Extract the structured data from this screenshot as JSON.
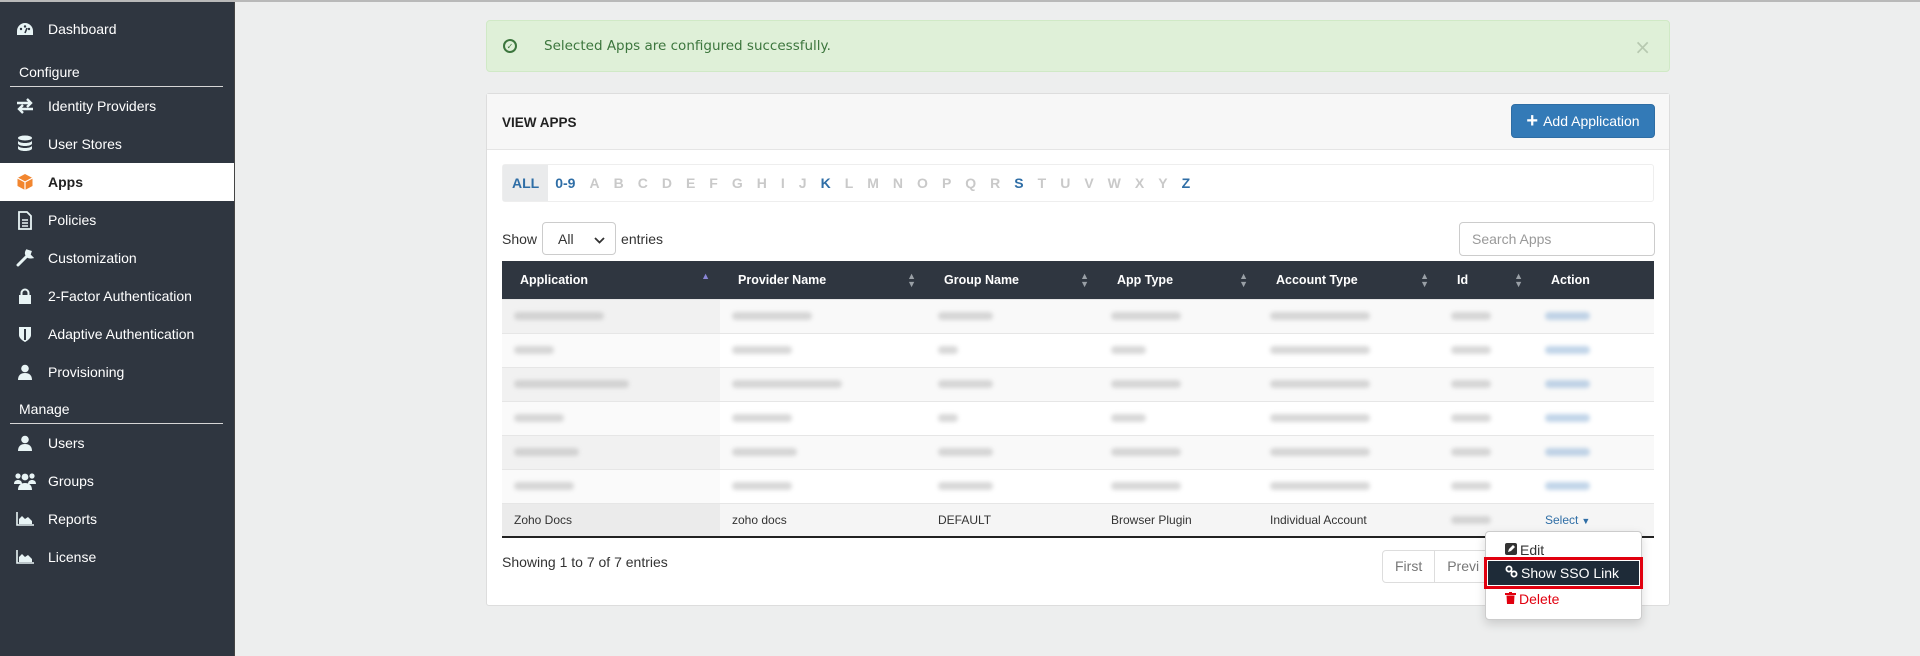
{
  "sidebar": {
    "items": [
      {
        "label": "Dashboard",
        "icon": "dashboard-icon"
      },
      {
        "section": "Configure"
      },
      {
        "label": "Identity Providers",
        "icon": "exchange-icon"
      },
      {
        "label": "User Stores",
        "icon": "database-icon"
      },
      {
        "label": "Apps",
        "icon": "cube-icon",
        "active": true
      },
      {
        "label": "Policies",
        "icon": "document-icon"
      },
      {
        "label": "Customization",
        "icon": "wrench-icon"
      },
      {
        "label": "2-Factor Authentication",
        "icon": "lock-icon"
      },
      {
        "label": "Adaptive Authentication",
        "icon": "shield-icon"
      },
      {
        "label": "Provisioning",
        "icon": "user-icon"
      },
      {
        "section": "Manage"
      },
      {
        "label": "Users",
        "icon": "user-icon"
      },
      {
        "label": "Groups",
        "icon": "users-icon"
      },
      {
        "label": "Reports",
        "icon": "area-chart-icon"
      },
      {
        "label": "License",
        "icon": "area-chart-icon"
      }
    ]
  },
  "alert": {
    "message": "Selected Apps are configured successfully.",
    "close": "×",
    "color": "#dff0d8"
  },
  "panel": {
    "title": "VIEW APPS",
    "add_button": "Add Application",
    "add_icon": "+"
  },
  "alpha_filter": {
    "items": [
      "ALL",
      "0-9",
      "A",
      "B",
      "C",
      "D",
      "E",
      "F",
      "G",
      "H",
      "I",
      "J",
      "K",
      "L",
      "M",
      "N",
      "O",
      "P",
      "Q",
      "R",
      "S",
      "T",
      "U",
      "V",
      "W",
      "X",
      "Y",
      "Z"
    ],
    "enabled": [
      "ALL",
      "0-9",
      "K",
      "S",
      "Z"
    ],
    "selected": "ALL"
  },
  "entries": {
    "show_label": "Show",
    "value": "All",
    "entries_label": "entries"
  },
  "search": {
    "placeholder": "Search Apps",
    "value": ""
  },
  "table": {
    "columns": [
      "Application",
      "Provider Name",
      "Group Name",
      "App Type",
      "Account Type",
      "Id",
      "Action"
    ],
    "sorted_column": "Application",
    "blurred_rows": 6,
    "last_row": {
      "application": "Zoho Docs",
      "provider": "zoho docs",
      "group": "DEFAULT",
      "app_type": "Browser Plugin",
      "account_type": "Individual Account",
      "id": "",
      "action": "Select"
    }
  },
  "footer": {
    "info": "Showing 1 to 7 of 7 entries",
    "pager": [
      "First",
      "Previ"
    ]
  },
  "action_menu": {
    "items": [
      {
        "label": "Edit",
        "icon": "edit-icon"
      },
      {
        "label": "Show SSO Link",
        "icon": "link-icon",
        "highlighted": true
      },
      {
        "label": "Delete",
        "icon": "trash-icon",
        "color": "#e1000f"
      }
    ]
  }
}
